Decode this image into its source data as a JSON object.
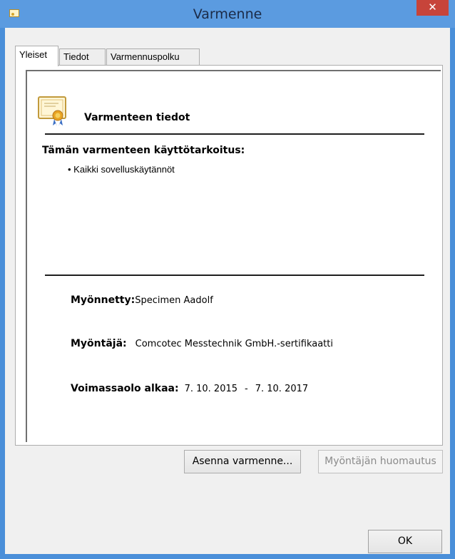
{
  "window": {
    "title": "Varmenne",
    "close_symbol": "✕"
  },
  "tabs": [
    {
      "label": "Yleiset"
    },
    {
      "label": "Tiedot"
    },
    {
      "label": "Varmennuspolku"
    }
  ],
  "general": {
    "heading": "Varmenteen tiedot",
    "icon": "certificate-icon",
    "purpose_title": "Tämän varmenteen käyttötarkoitus:",
    "purpose_items": [
      "• Kaikki sovelluskäytännöt"
    ],
    "issued_to_label": "Myönnetty:",
    "issued_to_value": "Specimen Aadolf",
    "issued_by_label": "Myöntäjä:",
    "issued_by_value": "Comcotec Messtechnik GmbH.-sertifikaatti",
    "valid_label": "Voimassaolo alkaa:",
    "valid_from": "7. 10. 2015",
    "valid_sep": "-",
    "valid_to": "7. 10. 2017"
  },
  "buttons": {
    "install": "Asenna varmenne...",
    "issuer_statement": "Myöntäjän huomautus",
    "ok": "OK"
  },
  "colors": {
    "titlebar": "#5b9be0",
    "close": "#c7443a",
    "dialog_bg": "#f0f0f0"
  }
}
